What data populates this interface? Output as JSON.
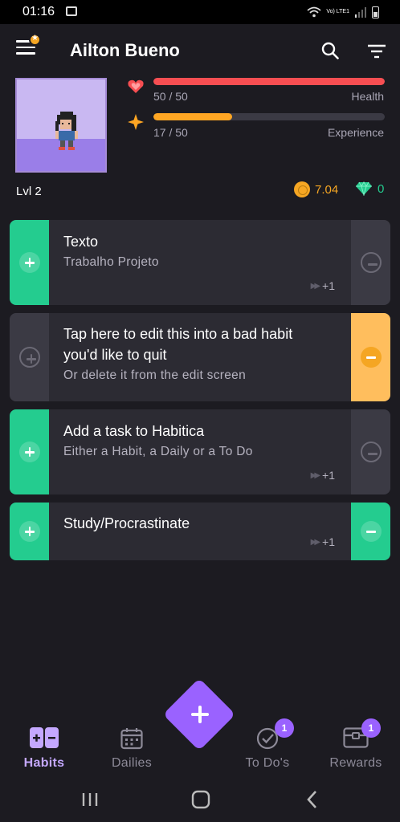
{
  "status_bar": {
    "time": "01:16",
    "network_label": "Vo) LTE1"
  },
  "header": {
    "user_name": "Ailton Bueno"
  },
  "avatar": {
    "level": "Lvl 2"
  },
  "stats": {
    "health": {
      "value": "50 / 50",
      "label": "Health",
      "fraction": 1.0,
      "color": "#f74e52"
    },
    "experience": {
      "value": "17 / 50",
      "label": "Experience",
      "fraction": 0.34,
      "color": "#ffa623"
    }
  },
  "currency": {
    "gold": "7.04",
    "gems": "0",
    "gold_color": "#f5a623",
    "gem_color": "#24cc8f"
  },
  "habits": [
    {
      "title": "Texto",
      "notes": "Trabalho Projeto",
      "streak": "+1",
      "up_color": "#24cc8f",
      "down_color": "#3b3a44"
    },
    {
      "title_line1": "Tap here to edit this into a bad habit",
      "title_line2": "you'd like to quit",
      "notes": "Or delete it from the edit screen",
      "up_color": "#3b3a44",
      "down_color": "#ffbe5d"
    },
    {
      "title": "Add a task to Habitica",
      "notes": "Either a Habit, a Daily or a To Do",
      "streak": "+1",
      "up_color": "#24cc8f",
      "down_color": "#3b3a44"
    },
    {
      "title": "Study/Procrastinate",
      "streak": "+1",
      "up_color": "#24cc8f",
      "down_color": "#24cc8f"
    }
  ],
  "bottom_nav": {
    "habits": "Habits",
    "dailies": "Dailies",
    "todos": "To Do's",
    "todos_badge": "1",
    "rewards": "Rewards",
    "rewards_badge": "1",
    "accent": "#9a62ff"
  }
}
